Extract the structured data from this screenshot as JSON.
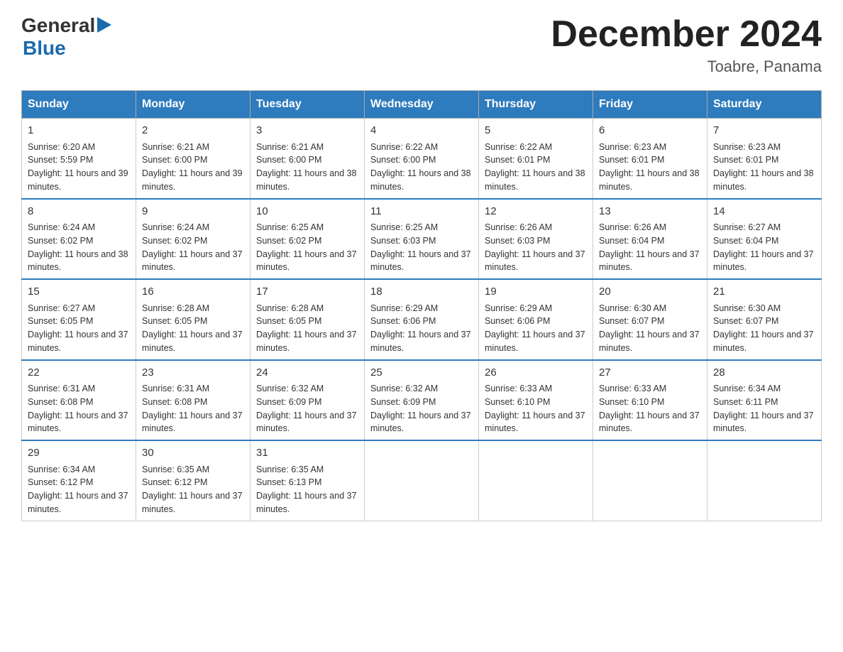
{
  "logo": {
    "general": "General",
    "blue": "Blue",
    "arrow": "▶"
  },
  "title": "December 2024",
  "subtitle": "Toabre, Panama",
  "days": [
    "Sunday",
    "Monday",
    "Tuesday",
    "Wednesday",
    "Thursday",
    "Friday",
    "Saturday"
  ],
  "weeks": [
    [
      {
        "num": "1",
        "sunrise": "6:20 AM",
        "sunset": "5:59 PM",
        "daylight": "11 hours and 39 minutes."
      },
      {
        "num": "2",
        "sunrise": "6:21 AM",
        "sunset": "6:00 PM",
        "daylight": "11 hours and 39 minutes."
      },
      {
        "num": "3",
        "sunrise": "6:21 AM",
        "sunset": "6:00 PM",
        "daylight": "11 hours and 38 minutes."
      },
      {
        "num": "4",
        "sunrise": "6:22 AM",
        "sunset": "6:00 PM",
        "daylight": "11 hours and 38 minutes."
      },
      {
        "num": "5",
        "sunrise": "6:22 AM",
        "sunset": "6:01 PM",
        "daylight": "11 hours and 38 minutes."
      },
      {
        "num": "6",
        "sunrise": "6:23 AM",
        "sunset": "6:01 PM",
        "daylight": "11 hours and 38 minutes."
      },
      {
        "num": "7",
        "sunrise": "6:23 AM",
        "sunset": "6:01 PM",
        "daylight": "11 hours and 38 minutes."
      }
    ],
    [
      {
        "num": "8",
        "sunrise": "6:24 AM",
        "sunset": "6:02 PM",
        "daylight": "11 hours and 38 minutes."
      },
      {
        "num": "9",
        "sunrise": "6:24 AM",
        "sunset": "6:02 PM",
        "daylight": "11 hours and 37 minutes."
      },
      {
        "num": "10",
        "sunrise": "6:25 AM",
        "sunset": "6:02 PM",
        "daylight": "11 hours and 37 minutes."
      },
      {
        "num": "11",
        "sunrise": "6:25 AM",
        "sunset": "6:03 PM",
        "daylight": "11 hours and 37 minutes."
      },
      {
        "num": "12",
        "sunrise": "6:26 AM",
        "sunset": "6:03 PM",
        "daylight": "11 hours and 37 minutes."
      },
      {
        "num": "13",
        "sunrise": "6:26 AM",
        "sunset": "6:04 PM",
        "daylight": "11 hours and 37 minutes."
      },
      {
        "num": "14",
        "sunrise": "6:27 AM",
        "sunset": "6:04 PM",
        "daylight": "11 hours and 37 minutes."
      }
    ],
    [
      {
        "num": "15",
        "sunrise": "6:27 AM",
        "sunset": "6:05 PM",
        "daylight": "11 hours and 37 minutes."
      },
      {
        "num": "16",
        "sunrise": "6:28 AM",
        "sunset": "6:05 PM",
        "daylight": "11 hours and 37 minutes."
      },
      {
        "num": "17",
        "sunrise": "6:28 AM",
        "sunset": "6:05 PM",
        "daylight": "11 hours and 37 minutes."
      },
      {
        "num": "18",
        "sunrise": "6:29 AM",
        "sunset": "6:06 PM",
        "daylight": "11 hours and 37 minutes."
      },
      {
        "num": "19",
        "sunrise": "6:29 AM",
        "sunset": "6:06 PM",
        "daylight": "11 hours and 37 minutes."
      },
      {
        "num": "20",
        "sunrise": "6:30 AM",
        "sunset": "6:07 PM",
        "daylight": "11 hours and 37 minutes."
      },
      {
        "num": "21",
        "sunrise": "6:30 AM",
        "sunset": "6:07 PM",
        "daylight": "11 hours and 37 minutes."
      }
    ],
    [
      {
        "num": "22",
        "sunrise": "6:31 AM",
        "sunset": "6:08 PM",
        "daylight": "11 hours and 37 minutes."
      },
      {
        "num": "23",
        "sunrise": "6:31 AM",
        "sunset": "6:08 PM",
        "daylight": "11 hours and 37 minutes."
      },
      {
        "num": "24",
        "sunrise": "6:32 AM",
        "sunset": "6:09 PM",
        "daylight": "11 hours and 37 minutes."
      },
      {
        "num": "25",
        "sunrise": "6:32 AM",
        "sunset": "6:09 PM",
        "daylight": "11 hours and 37 minutes."
      },
      {
        "num": "26",
        "sunrise": "6:33 AM",
        "sunset": "6:10 PM",
        "daylight": "11 hours and 37 minutes."
      },
      {
        "num": "27",
        "sunrise": "6:33 AM",
        "sunset": "6:10 PM",
        "daylight": "11 hours and 37 minutes."
      },
      {
        "num": "28",
        "sunrise": "6:34 AM",
        "sunset": "6:11 PM",
        "daylight": "11 hours and 37 minutes."
      }
    ],
    [
      {
        "num": "29",
        "sunrise": "6:34 AM",
        "sunset": "6:12 PM",
        "daylight": "11 hours and 37 minutes."
      },
      {
        "num": "30",
        "sunrise": "6:35 AM",
        "sunset": "6:12 PM",
        "daylight": "11 hours and 37 minutes."
      },
      {
        "num": "31",
        "sunrise": "6:35 AM",
        "sunset": "6:13 PM",
        "daylight": "11 hours and 37 minutes."
      },
      null,
      null,
      null,
      null
    ]
  ],
  "labels": {
    "sunrise": "Sunrise:",
    "sunset": "Sunset:",
    "daylight": "Daylight:"
  }
}
